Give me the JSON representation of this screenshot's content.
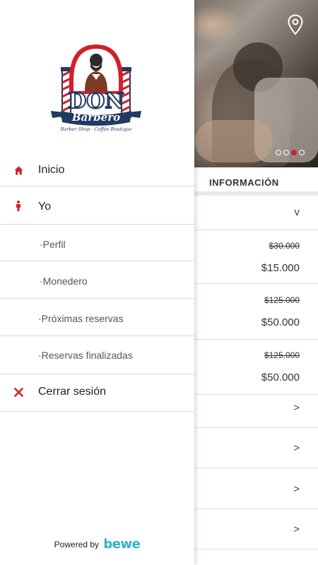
{
  "hero": {
    "indicator": {
      "count": 4,
      "active_index": 2
    }
  },
  "info": {
    "title": "INFORMACIÓN"
  },
  "services": [
    {
      "chevron": "v"
    },
    {
      "old_price": "$30.000",
      "price": "$15.000"
    },
    {
      "old_price": "$125.000",
      "price": "$50.000"
    },
    {
      "old_price": "$125.000",
      "price": "$50.000"
    },
    {
      "chevron": ">"
    },
    {
      "chevron": ">"
    },
    {
      "chevron": ">"
    },
    {
      "chevron": ">"
    }
  ],
  "logo": {
    "text_main": "DON",
    "text_script": "Barbero",
    "tagline": "Barber Shop · Coffee Boutique"
  },
  "menu": {
    "inicio": {
      "label": "Inicio",
      "icon": "home-icon"
    },
    "yo": {
      "label": "Yo",
      "icon": "person-icon"
    },
    "perfil": {
      "label": "·Perfil"
    },
    "monedero": {
      "label": "·Monedero"
    },
    "proximas": {
      "label": "·Próximas reservas"
    },
    "finalizadas": {
      "label": "·Reservas finalizadas"
    },
    "logout": {
      "label": "Cerrar sesión",
      "icon": "close-icon"
    }
  },
  "footer": {
    "powered_text": "Powered by",
    "brand": "bewe"
  },
  "colors": {
    "accent": "#d0202a",
    "brand": "#2ab3c6",
    "logo_navy": "#1f3a63"
  }
}
